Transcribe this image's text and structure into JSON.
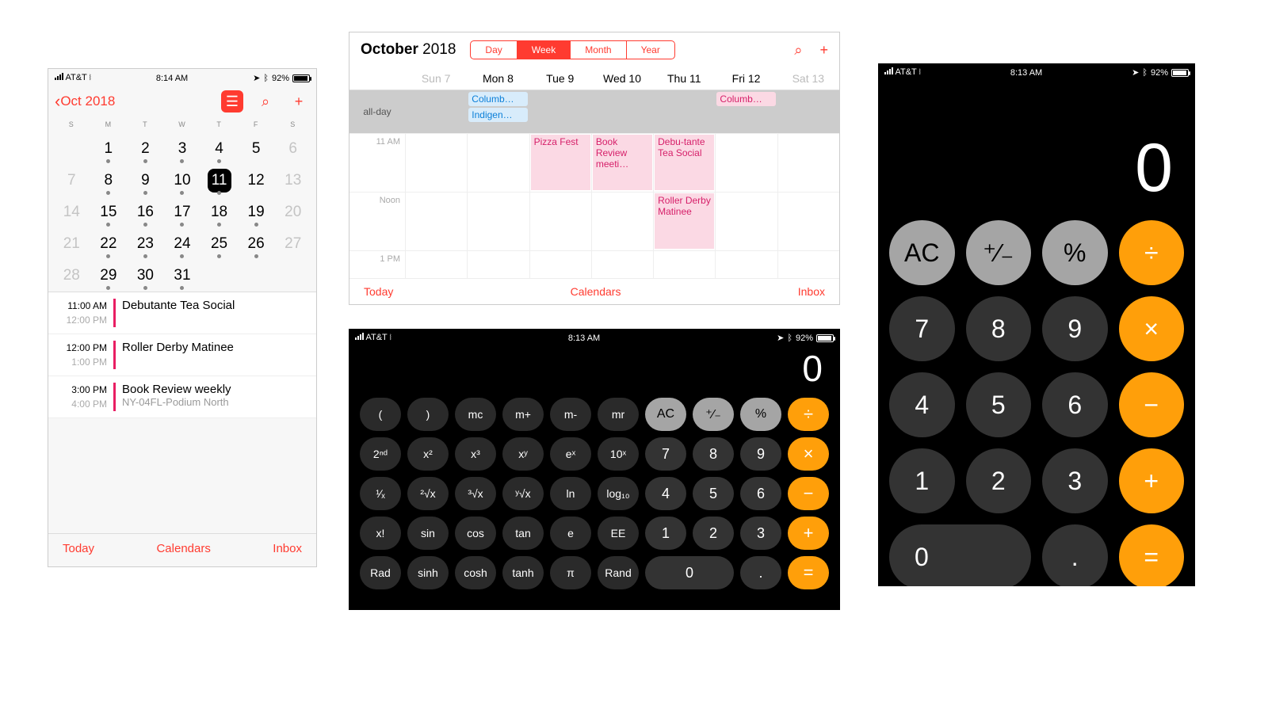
{
  "statusbar": {
    "carrier": "AT&T",
    "time_cal": "8:14 AM",
    "time_calc": "8:13 AM",
    "battery": "92%"
  },
  "iphone_cal": {
    "back_label": "Oct 2018",
    "dow": [
      "S",
      "M",
      "T",
      "W",
      "T",
      "F",
      "S"
    ],
    "weeks": [
      [
        {
          "n": "",
          "g": 1
        },
        {
          "n": "1",
          "dot": 1
        },
        {
          "n": "2",
          "dot": 1
        },
        {
          "n": "3",
          "dot": 1
        },
        {
          "n": "4",
          "dot": 1
        },
        {
          "n": "5"
        },
        {
          "n": "6",
          "g": 1
        }
      ],
      [
        {
          "n": "7",
          "g": 1
        },
        {
          "n": "8",
          "dot": 1
        },
        {
          "n": "9",
          "dot": 1
        },
        {
          "n": "10",
          "dot": 1
        },
        {
          "n": "11",
          "dot": 1,
          "sel": 1
        },
        {
          "n": "12"
        },
        {
          "n": "13",
          "g": 1
        }
      ],
      [
        {
          "n": "14",
          "g": 1
        },
        {
          "n": "15",
          "dot": 1
        },
        {
          "n": "16",
          "dot": 1
        },
        {
          "n": "17",
          "dot": 1
        },
        {
          "n": "18",
          "dot": 1
        },
        {
          "n": "19",
          "dot": 1
        },
        {
          "n": "20",
          "g": 1
        }
      ],
      [
        {
          "n": "21",
          "g": 1
        },
        {
          "n": "22",
          "dot": 1
        },
        {
          "n": "23",
          "dot": 1
        },
        {
          "n": "24",
          "dot": 1
        },
        {
          "n": "25",
          "dot": 1
        },
        {
          "n": "26",
          "dot": 1
        },
        {
          "n": "27",
          "g": 1
        }
      ],
      [
        {
          "n": "28",
          "g": 1
        },
        {
          "n": "29",
          "dot": 1
        },
        {
          "n": "30",
          "dot": 1
        },
        {
          "n": "31",
          "dot": 1
        },
        {
          "n": ""
        },
        {
          "n": ""
        },
        {
          "n": ""
        }
      ]
    ],
    "events": [
      {
        "t1": "11:00 AM",
        "t2": "12:00 PM",
        "title": "Debutante Tea Social",
        "sub": ""
      },
      {
        "t1": "12:00 PM",
        "t2": "1:00 PM",
        "title": "Roller Derby Matinee",
        "sub": ""
      },
      {
        "t1": "3:00 PM",
        "t2": "4:00 PM",
        "title": "Book Review weekly",
        "sub": "NY-04FL-Podium North"
      }
    ],
    "tabbar": {
      "today": "Today",
      "calendars": "Calendars",
      "inbox": "Inbox"
    }
  },
  "ipad_cal": {
    "title_month": "October",
    "title_year": "2018",
    "seg": [
      "Day",
      "Week",
      "Month",
      "Year"
    ],
    "seg_active": 1,
    "days": [
      "Sun 7",
      "Mon 8",
      "Tue 9",
      "Wed 10",
      "Thu 11",
      "Fri 12",
      "Sat 13"
    ],
    "allday_label": "all-day",
    "allday": {
      "1": [
        {
          "t": "Columb…",
          "c": "blue"
        },
        {
          "t": "Indigen…",
          "c": "blue"
        }
      ],
      "5": [
        {
          "t": "Columb…",
          "c": "pink"
        }
      ]
    },
    "hours": [
      "11 AM",
      "Noon",
      "1 PM"
    ],
    "timed": [
      {
        "col": 2,
        "row": 0,
        "h": 1,
        "t": "Pizza Fest"
      },
      {
        "col": 3,
        "row": 0,
        "h": 1,
        "t": "Book Review meeti…"
      },
      {
        "col": 4,
        "row": 0,
        "h": 1,
        "t": "Debu-tante Tea Social"
      },
      {
        "col": 4,
        "row": 1,
        "h": 1,
        "t": "Roller Derby Matinee"
      }
    ],
    "footer": {
      "today": "Today",
      "calendars": "Calendars",
      "inbox": "Inbox"
    }
  },
  "calc_ls": {
    "display": "0",
    "rows": [
      [
        {
          "l": "(",
          "c": "sci"
        },
        {
          "l": ")",
          "c": "sci"
        },
        {
          "l": "mc",
          "c": "sci"
        },
        {
          "l": "m+",
          "c": "sci"
        },
        {
          "l": "m-",
          "c": "sci"
        },
        {
          "l": "mr",
          "c": "sci"
        },
        {
          "l": "AC",
          "c": "fn"
        },
        {
          "l": "⁺∕₋",
          "c": "fn"
        },
        {
          "l": "%",
          "c": "fn"
        },
        {
          "l": "÷",
          "c": "op"
        }
      ],
      [
        {
          "l": "2ⁿᵈ",
          "c": "sci"
        },
        {
          "l": "x²",
          "c": "sci"
        },
        {
          "l": "x³",
          "c": "sci"
        },
        {
          "l": "xʸ",
          "c": "sci"
        },
        {
          "l": "eˣ",
          "c": "sci"
        },
        {
          "l": "10ˣ",
          "c": "sci"
        },
        {
          "l": "7",
          "c": "num"
        },
        {
          "l": "8",
          "c": "num"
        },
        {
          "l": "9",
          "c": "num"
        },
        {
          "l": "×",
          "c": "op"
        }
      ],
      [
        {
          "l": "¹∕ₓ",
          "c": "sci"
        },
        {
          "l": "²√x",
          "c": "sci"
        },
        {
          "l": "³√x",
          "c": "sci"
        },
        {
          "l": "ʸ√x",
          "c": "sci"
        },
        {
          "l": "ln",
          "c": "sci"
        },
        {
          "l": "log₁₀",
          "c": "sci"
        },
        {
          "l": "4",
          "c": "num"
        },
        {
          "l": "5",
          "c": "num"
        },
        {
          "l": "6",
          "c": "num"
        },
        {
          "l": "−",
          "c": "op"
        }
      ],
      [
        {
          "l": "x!",
          "c": "sci"
        },
        {
          "l": "sin",
          "c": "sci"
        },
        {
          "l": "cos",
          "c": "sci"
        },
        {
          "l": "tan",
          "c": "sci"
        },
        {
          "l": "e",
          "c": "sci"
        },
        {
          "l": "EE",
          "c": "sci"
        },
        {
          "l": "1",
          "c": "num"
        },
        {
          "l": "2",
          "c": "num"
        },
        {
          "l": "3",
          "c": "num"
        },
        {
          "l": "+",
          "c": "op"
        }
      ],
      [
        {
          "l": "Rad",
          "c": "sci"
        },
        {
          "l": "sinh",
          "c": "sci"
        },
        {
          "l": "cosh",
          "c": "sci"
        },
        {
          "l": "tanh",
          "c": "sci"
        },
        {
          "l": "π",
          "c": "sci"
        },
        {
          "l": "Rand",
          "c": "sci"
        },
        {
          "l": "0",
          "c": "num",
          "w": 2
        },
        {
          "l": ".",
          "c": "num"
        },
        {
          "l": "=",
          "c": "op"
        }
      ]
    ]
  },
  "calc_pt": {
    "display": "0",
    "rows": [
      [
        {
          "l": "AC",
          "c": "fn"
        },
        {
          "l": "⁺∕₋",
          "c": "fn"
        },
        {
          "l": "%",
          "c": "fn"
        },
        {
          "l": "÷",
          "c": "op"
        }
      ],
      [
        {
          "l": "7"
        },
        {
          "l": "8"
        },
        {
          "l": "9"
        },
        {
          "l": "×",
          "c": "op"
        }
      ],
      [
        {
          "l": "4"
        },
        {
          "l": "5"
        },
        {
          "l": "6"
        },
        {
          "l": "−",
          "c": "op"
        }
      ],
      [
        {
          "l": "1"
        },
        {
          "l": "2"
        },
        {
          "l": "3"
        },
        {
          "l": "+",
          "c": "op"
        }
      ],
      [
        {
          "l": "0",
          "w": 2
        },
        {
          "l": "."
        },
        {
          "l": "=",
          "c": "op"
        }
      ]
    ]
  }
}
